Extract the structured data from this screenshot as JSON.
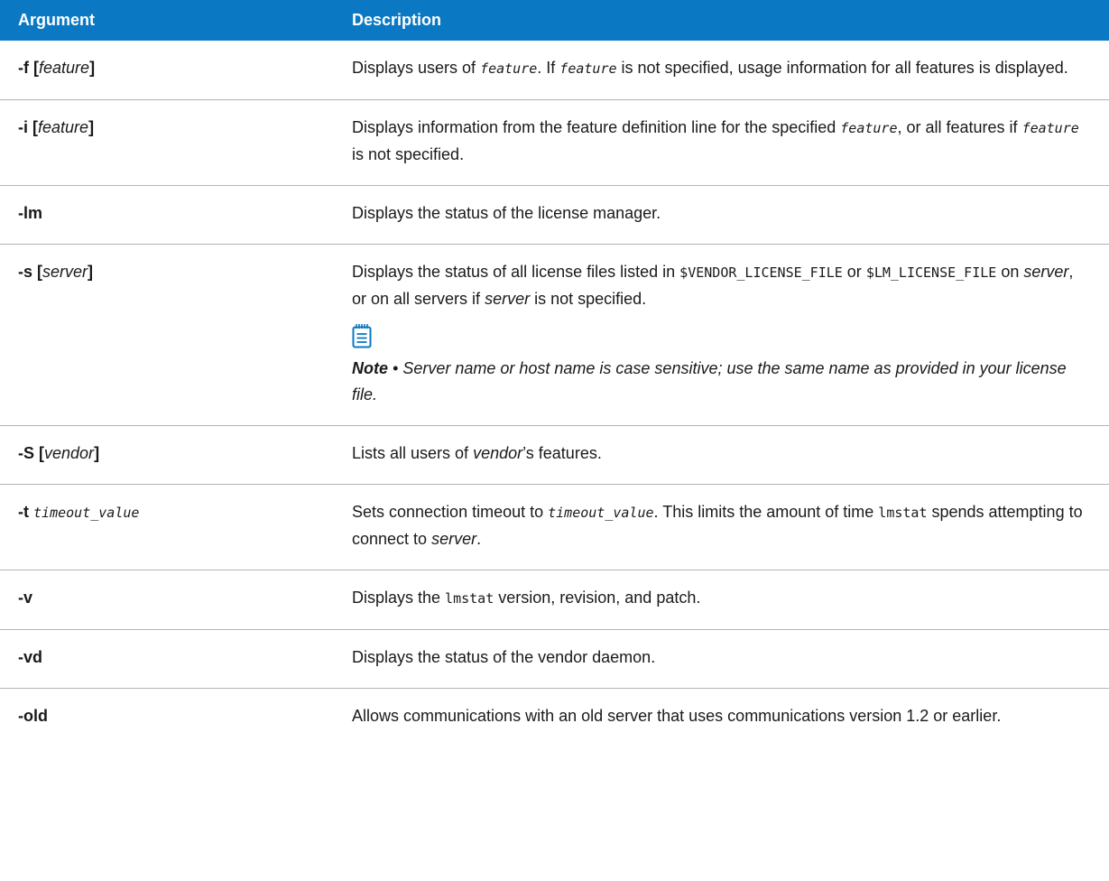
{
  "header": {
    "argument": "Argument",
    "description": "Description"
  },
  "rows": [
    {
      "arg": {
        "flag": "-f",
        "open": "[",
        "param": "feature",
        "close": "]"
      },
      "desc": {
        "a": "Displays users of ",
        "b": "feature",
        "c": ". If ",
        "d": "feature",
        "e": " is not specified, usage information for all features is displayed."
      }
    },
    {
      "arg": {
        "flag": "-i",
        "open": "[",
        "param": "feature",
        "close": "]"
      },
      "desc": {
        "a": "Displays information from the feature definition line for the specified ",
        "b": "feature",
        "c": ", or all features if ",
        "d": "feature",
        "e": " is not specified."
      }
    },
    {
      "arg": {
        "flag": "-lm"
      },
      "desc": {
        "a": "Displays the status of the license manager."
      }
    },
    {
      "arg": {
        "flag": "-s",
        "open": "[",
        "param": "server",
        "close": "]"
      },
      "desc": {
        "a": "Displays the status of all license files listed in ",
        "code1": "$VENDOR_LICENSE_FILE",
        "b": " or ",
        "code2": "$LM_LICENSE_FILE",
        "c": " on ",
        "d": "server",
        "e": ", or on all servers if ",
        "f": "server",
        "g": " is not specified."
      },
      "note": {
        "icon": "notepad-icon",
        "label": "Note",
        "bullet": " • ",
        "text": "Server name or host name is case sensitive; use the same name as provided in your license file."
      }
    },
    {
      "arg": {
        "flag": "-S",
        "open": "[",
        "param": "vendor",
        "close": "]"
      },
      "desc": {
        "a": "Lists all users of ",
        "b": "vendor",
        "c": "’s features."
      }
    },
    {
      "arg": {
        "flag": "-t",
        "param": "timeout_value"
      },
      "desc": {
        "a": "Sets connection timeout to ",
        "b": "timeout_value",
        "c": ". This limits the amount of time ",
        "code1": "lmstat",
        "d": " spends attempting to connect to ",
        "e": "server",
        "f": "."
      }
    },
    {
      "arg": {
        "flag": "-v"
      },
      "desc": {
        "a": "Displays the ",
        "code1": "lmstat",
        "b": " version, revision, and patch."
      }
    },
    {
      "arg": {
        "flag": "-vd"
      },
      "desc": {
        "a": "Displays the status of the vendor daemon."
      }
    },
    {
      "arg": {
        "flag": "-old"
      },
      "desc": {
        "a": "Allows communications with an old server that uses communications version 1.2 or earlier."
      }
    }
  ],
  "colors": {
    "header_bg": "#0a78c2",
    "icon": "#0a78c2",
    "row_border": "#b4b4b4"
  }
}
